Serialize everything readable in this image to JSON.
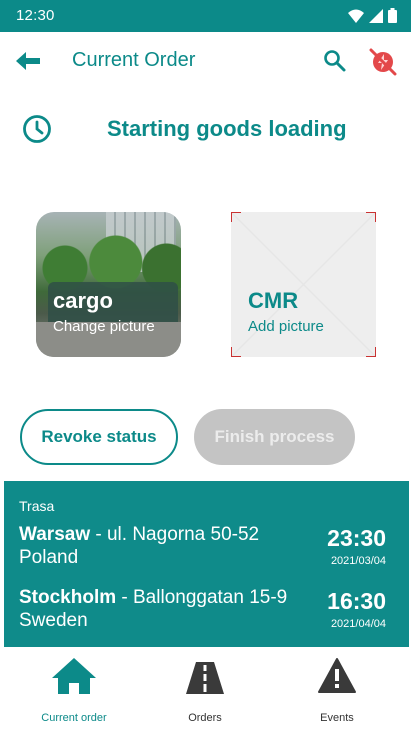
{
  "statusbar": {
    "time": "12:30"
  },
  "appbar": {
    "title": "Current Order"
  },
  "status": {
    "text": "Starting goods loading"
  },
  "pictures": [
    {
      "name": "cargo",
      "action": "Change picture"
    },
    {
      "name": "CMR",
      "action": "Add picture"
    }
  ],
  "buttons": {
    "revoke": "Revoke status",
    "finish": "Finish process"
  },
  "route": {
    "label": "Trasa",
    "stops": [
      {
        "city": "Warsaw",
        "address": " - ul. Nagorna 50-52",
        "country": "Poland",
        "time": "23:30",
        "date": "2021/03/04"
      },
      {
        "city": "Stockholm",
        "address": " - Ballonggatan 15-9",
        "country": "Sweden",
        "time": "16:30",
        "date": "2021/04/04"
      }
    ]
  },
  "nav": [
    {
      "label": "Current order",
      "icon": "home-icon",
      "active": true
    },
    {
      "label": "Orders",
      "icon": "road-icon",
      "active": false
    },
    {
      "label": "Events",
      "icon": "warning-icon",
      "active": false
    }
  ],
  "colors": {
    "primary": "#0c8a89",
    "disabled": "#c4c4c4",
    "alert": "#c93232"
  }
}
